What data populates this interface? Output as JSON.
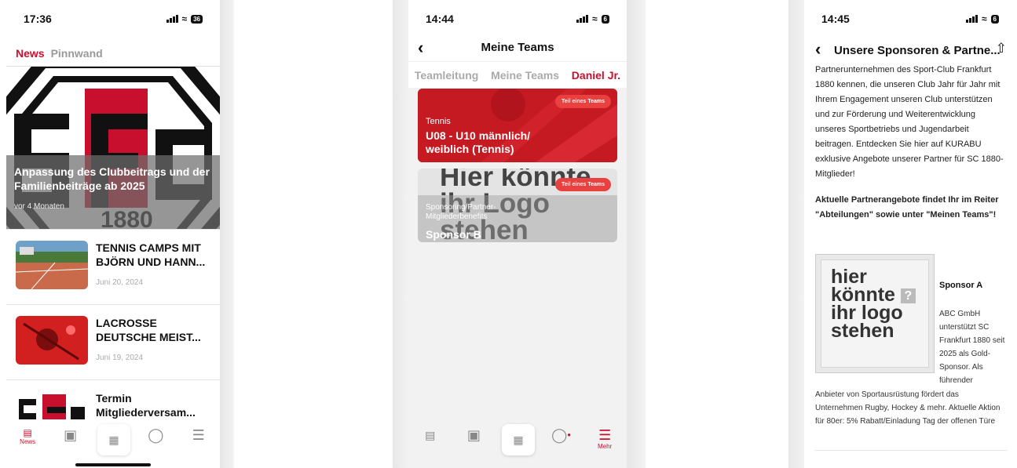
{
  "screen1": {
    "time": "17:36",
    "battery": "36",
    "tabs": {
      "news": "News",
      "pinnwand": "Pinnwand"
    },
    "hero": {
      "title": "Anpassung des Clubbeitrags und der Familienbeiträge ab 2025",
      "date": "vor 4 Monaten"
    },
    "news": [
      {
        "title": "TENNIS CAMPS MIT BJÖRN UND HANN...",
        "date": "Juni 20, 2024"
      },
      {
        "title": "LACROSSE DEUTSCHE MEIST...",
        "date": "Juni 19, 2024"
      },
      {
        "title": "Termin Mitgliederversam...",
        "date": ""
      }
    ],
    "nav": {
      "news_label": "News"
    }
  },
  "screen2": {
    "time": "14:44",
    "battery": "6",
    "title": "Meine Teams",
    "tabs": [
      "Teamleitung",
      "Meine Teams",
      "Daniel Jr."
    ],
    "cards": [
      {
        "tag": "Teil eines Teams",
        "sub": "Tennis",
        "title": "U08 - U10 männlich/ weiblich (Tennis)"
      },
      {
        "tag": "Teil eines Teams",
        "sub": "Sponsoring/Partner-Mitgliederbenefits",
        "title": "Sponsor B",
        "bg_text": "Hier könnte ihr Logo stehen"
      }
    ],
    "nav": {
      "more_label": "Mehr"
    }
  },
  "screen3": {
    "time": "14:45",
    "battery": "6",
    "title": "Unsere Sponsoren & Partne...",
    "intro": "Partnerunternehmen des Sport-Club Frankfurt 1880 kennen, die unseren Club Jahr für Jahr mit Ihrem Engagement unseren Club unterstützen und zur Förderung und Weiterentwicklung unseres Sportbetriebs und Jugendarbeit beitragen. Entdecken Sie hier auf KURABU exklusive Angebote unserer Partner für SC 1880-Mitglieder!",
    "bold_note": "Aktuelle Partnerangebote findet Ihr im Reiter \"Abteilungen\" sowie unter \"Meinen Teams\"!",
    "logo_text": {
      "l1": "hier",
      "l2": "könnte",
      "l3": "ihr logo",
      "l4": "stehen"
    },
    "sponsor": {
      "name": "Sponsor A",
      "side": "ABC GmbH unterstützt SC Frankfurt 1880 seit 2025 als Gold-Sponsor. Als führender",
      "bottom": "Anbieter von Sportausrüstung fördert das Unternehmen Rugby, Hockey & mehr. Aktuelle Aktion für 80er: 5% Rabatt/Einladung Tag der offenen Türe"
    }
  },
  "colors": {
    "accent": "#c8102e",
    "tag": "#e8413f"
  },
  "icons": [
    "signal-icon",
    "wifi-icon",
    "battery-icon",
    "news-icon",
    "calendar-icon",
    "qr-code-icon",
    "chat-icon",
    "menu-icon",
    "back-icon",
    "share-icon"
  ]
}
